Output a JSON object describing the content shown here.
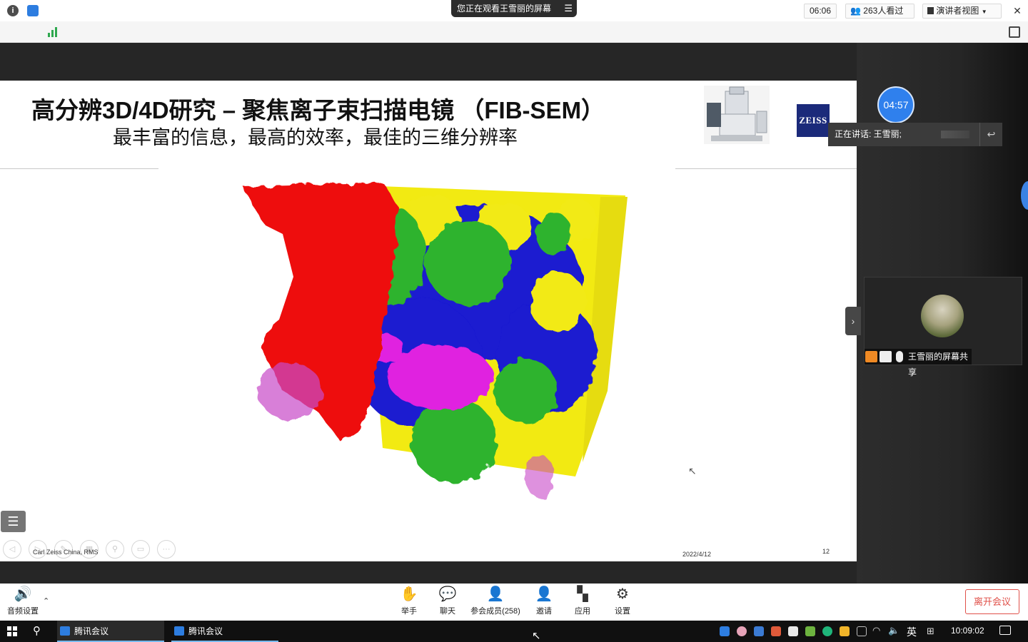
{
  "titlebar": {
    "share_banner": "您正在观看王雪丽的屏幕",
    "menu_icon": "list-icon"
  },
  "toolbar": {
    "elapsed": "06:06",
    "viewers": "263人看过",
    "view_mode": "演讲者视图"
  },
  "slide": {
    "title": "高分辨3D/4D研究 – 聚焦离子束扫描电镜 （FIB-SEM）",
    "subtitle": "最丰富的信息，最高的效率，最佳的三维分辨率",
    "logo": "ZEISS",
    "footer_left": "Carl Zeiss China,  RMS",
    "footer_date": "2022/4/12",
    "page_number": "12"
  },
  "right_panel": {
    "timer": "04:57",
    "speaking": "正在讲话: 王雪丽;",
    "tile_label": "王雪丽的屏幕共享"
  },
  "controls": {
    "audio": "音频设置",
    "raise_hand": "举手",
    "chat": "聊天",
    "members": "参会成员(258)",
    "invite": "邀请",
    "apps": "应用",
    "settings": "设置",
    "leave": "离开会议"
  },
  "taskbar": {
    "app1": "腾讯会议",
    "app2": "腾讯会议",
    "ime": "英",
    "time": "10:09:02"
  }
}
